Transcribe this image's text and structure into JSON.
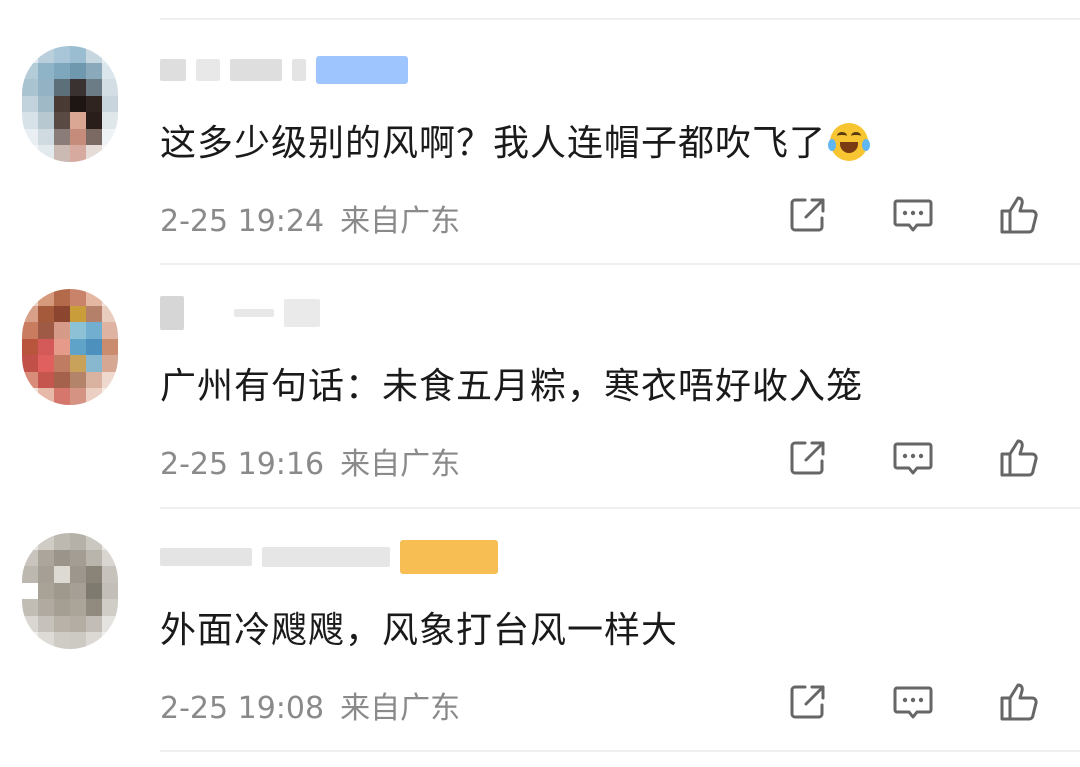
{
  "comments": [
    {
      "text": "这多少级别的风啊？我人连帽子都吹飞了",
      "emoji": "laughing-tears-emoji",
      "time": "2-25 19:24",
      "location": "来自广东",
      "badge_color": "#7fb2ff",
      "avatar_style": "cool"
    },
    {
      "text": "广州有句话：未食五月粽，寒衣唔好收入笼",
      "time": "2-25 19:16",
      "location": "来自广东",
      "avatar_style": "warm"
    },
    {
      "text": "外面冷飕飕，风象打台风一样大",
      "time": "2-25 19:08",
      "location": "来自广东",
      "badge_color": "#f5b335",
      "avatar_style": "gray"
    }
  ],
  "icons": {
    "share": "share-icon",
    "comment": "comment-icon",
    "like": "thumbs-up-icon"
  },
  "colors": {
    "text": "#1a1a1a",
    "meta": "#8a8a8a",
    "icon": "#666666",
    "divider": "#efefef"
  }
}
